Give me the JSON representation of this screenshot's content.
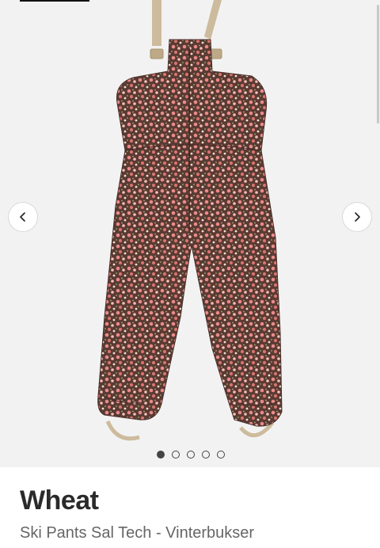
{
  "brand": "Wheat",
  "product_name": "Ski Pants Sal Tech - Vinterbukser",
  "gallery": {
    "prev_icon": "chevron-left-icon",
    "next_icon": "chevron-right-icon",
    "image_count": 5,
    "active_index": 0,
    "image_subject": "floral-print-ski-bib-pants"
  },
  "colors": {
    "gallery_bg": "#f2f2f2",
    "fabric_base": "#5a3a33",
    "flower_pink": "#e98b8a",
    "strap": "#cdbb9d",
    "dot": "#444444",
    "brand_text": "#2a2a2a",
    "name_text": "#666666"
  }
}
